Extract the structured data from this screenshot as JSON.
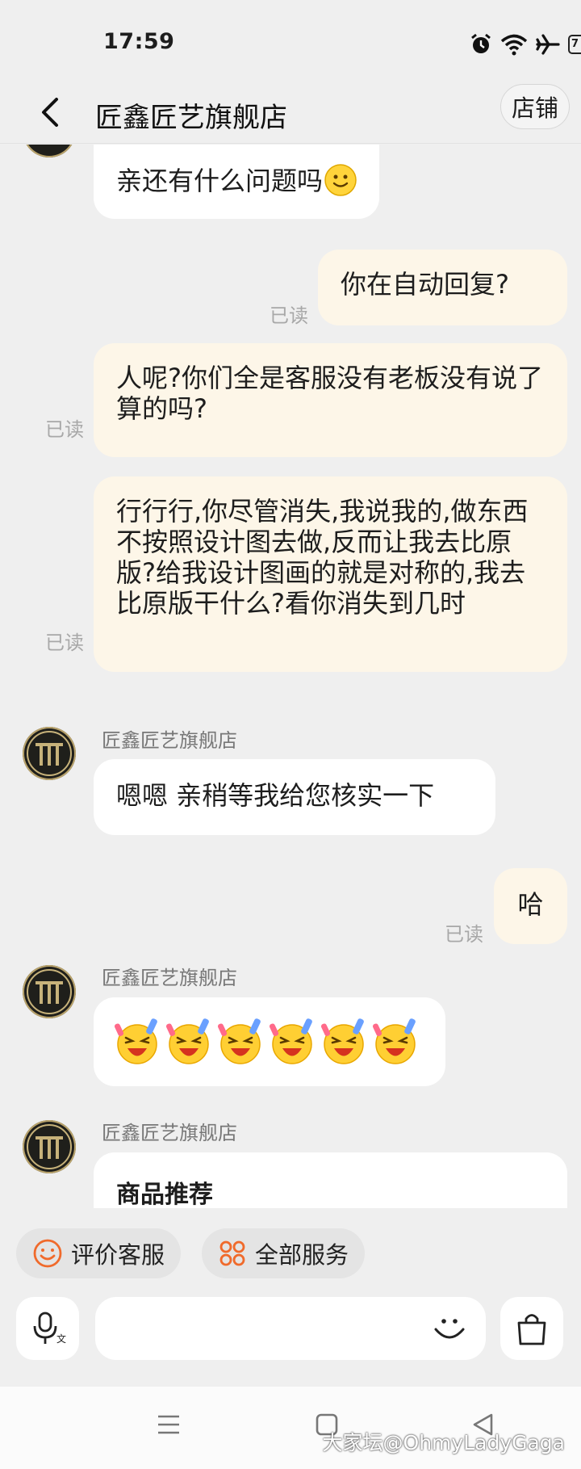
{
  "status_bar": {
    "time": "17:59",
    "battery": "7"
  },
  "header": {
    "title": "匠鑫匠艺旗舰店",
    "shop_button": "店铺"
  },
  "messages": [
    {
      "type": "received",
      "text": "亲还有什么问题吗",
      "emoji": "smiley"
    },
    {
      "type": "sent",
      "text": "你在自动回复?",
      "status": "已读"
    },
    {
      "type": "sent",
      "text": "人呢?你们全是客服没有老板没有说了算的吗?",
      "status": "已读"
    },
    {
      "type": "sent",
      "text": "行行行,你尽管消失,我说我的,做东西不按照设计图去做,反而让我去比原版?给我设计图画的就是对称的,我去比原版干什么?看你消失到几时",
      "status": "已读"
    },
    {
      "type": "received",
      "sender": "匠鑫匠艺旗舰店",
      "text": "嗯嗯 亲稍等我给您核实一下"
    },
    {
      "type": "sent",
      "text": "哈",
      "status": "已读"
    },
    {
      "type": "received",
      "sender": "匠鑫匠艺旗舰店",
      "emoji_count": 6,
      "emoji": "celebrating-face"
    },
    {
      "type": "received",
      "sender": "匠鑫匠艺旗舰店",
      "card_title": "商品推荐"
    }
  ],
  "services": {
    "rate": "评价客服",
    "all": "全部服务"
  },
  "input": {
    "placeholder": ""
  },
  "watermark": "大家坛@OhmyLadyGaga",
  "colors": {
    "background": "#efefef",
    "sent_bubble": "#fdf6e8",
    "received_bubble": "#ffffff",
    "accent": "#f06a2b"
  }
}
